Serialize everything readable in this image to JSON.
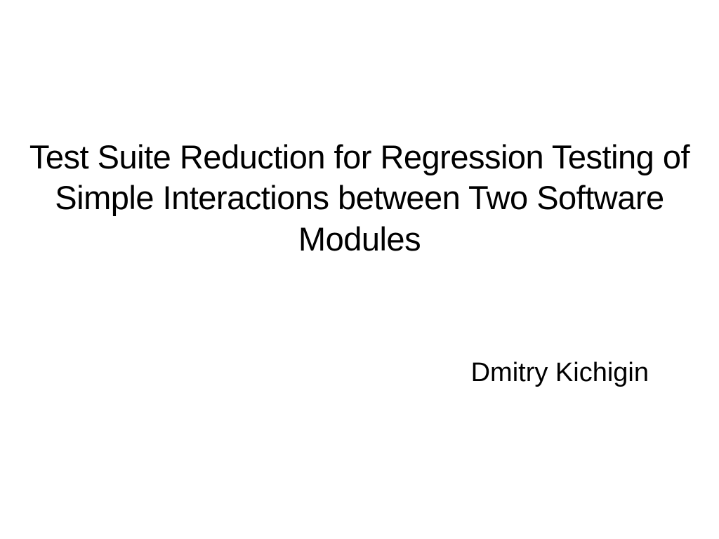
{
  "slide": {
    "title": "Test Suite Reduction for Regression Testing of Simple Interactions between Two Software Modules",
    "author": "Dmitry Kichigin"
  }
}
